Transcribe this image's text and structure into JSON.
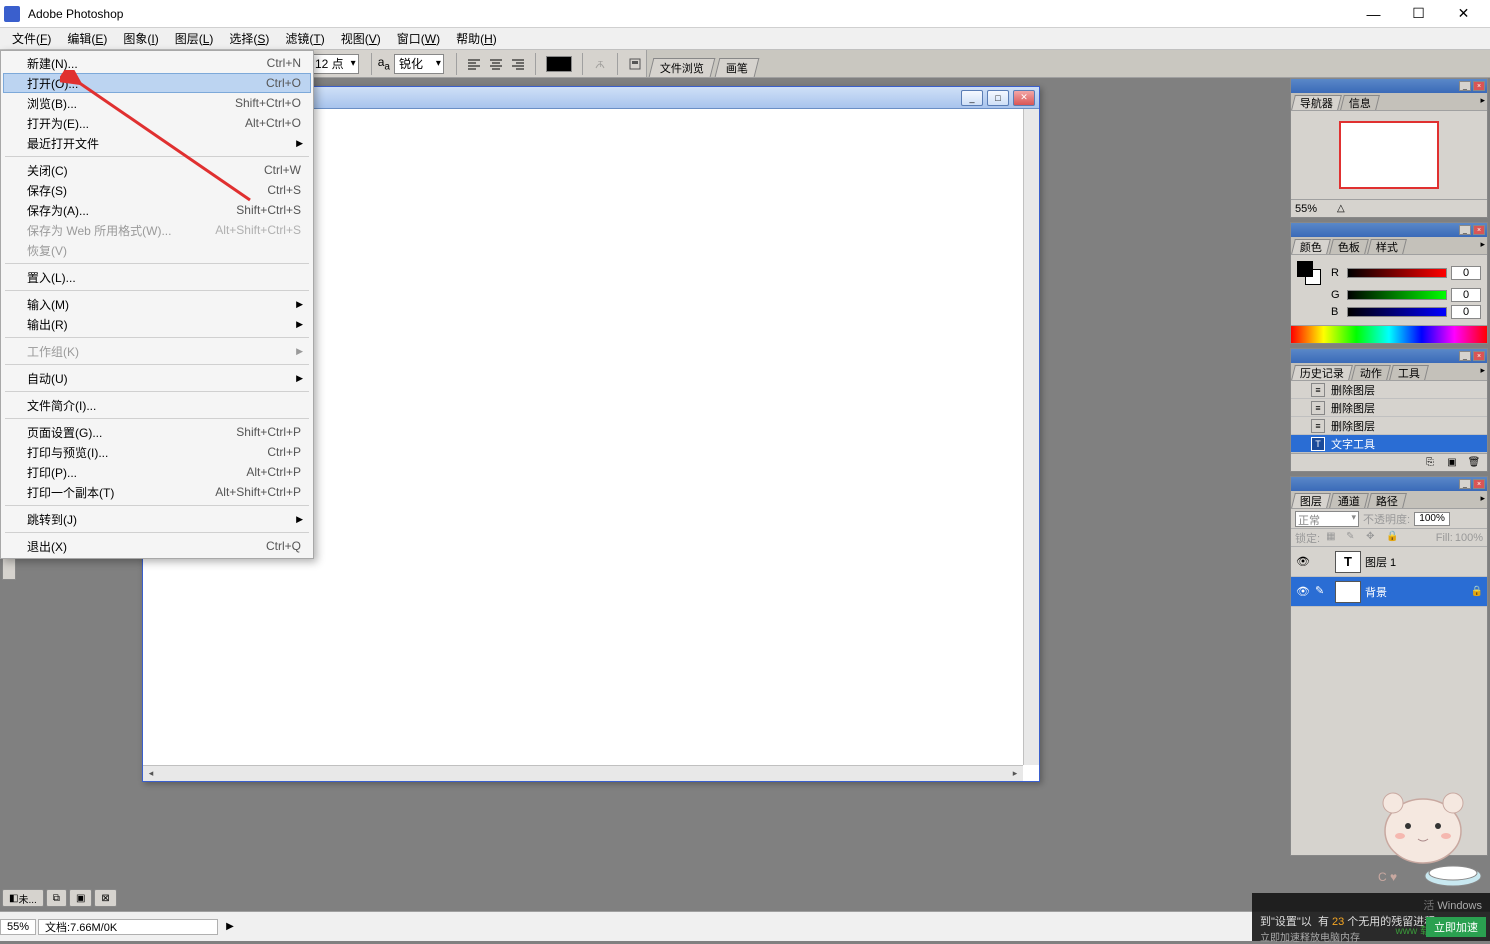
{
  "titlebar": {
    "title": "Adobe Photoshop"
  },
  "menubar": {
    "items": [
      {
        "label": "文件",
        "key": "F"
      },
      {
        "label": "编辑",
        "key": "E"
      },
      {
        "label": "图象",
        "key": "I"
      },
      {
        "label": "图层",
        "key": "L"
      },
      {
        "label": "选择",
        "key": "S"
      },
      {
        "label": "滤镜",
        "key": "T"
      },
      {
        "label": "视图",
        "key": "V"
      },
      {
        "label": "窗口",
        "key": "W"
      },
      {
        "label": "帮助",
        "key": "H"
      }
    ]
  },
  "file_menu": {
    "items": [
      {
        "label": "新建(N)...",
        "shortcut": "Ctrl+N"
      },
      {
        "label": "打开(O)...",
        "shortcut": "Ctrl+O",
        "highlighted": true
      },
      {
        "label": "浏览(B)...",
        "shortcut": "Shift+Ctrl+O"
      },
      {
        "label": "打开为(E)...",
        "shortcut": "Alt+Ctrl+O"
      },
      {
        "label": "最近打开文件",
        "submenu": true
      },
      {
        "sep": true
      },
      {
        "label": "关闭(C)",
        "shortcut": "Ctrl+W"
      },
      {
        "label": "保存(S)",
        "shortcut": "Ctrl+S"
      },
      {
        "label": "保存为(A)...",
        "shortcut": "Shift+Ctrl+S"
      },
      {
        "label": "保存为 Web 所用格式(W)...",
        "shortcut": "Alt+Shift+Ctrl+S",
        "disabled": true
      },
      {
        "label": "恢复(V)",
        "disabled": true
      },
      {
        "sep": true
      },
      {
        "label": "置入(L)..."
      },
      {
        "sep": true
      },
      {
        "label": "输入(M)",
        "submenu": true
      },
      {
        "label": "输出(R)",
        "submenu": true
      },
      {
        "sep": true
      },
      {
        "label": "工作组(K)",
        "submenu": true,
        "disabled": true
      },
      {
        "sep": true
      },
      {
        "label": "自动(U)",
        "submenu": true
      },
      {
        "sep": true
      },
      {
        "label": "文件简介(I)..."
      },
      {
        "sep": true
      },
      {
        "label": "页面设置(G)...",
        "shortcut": "Shift+Ctrl+P"
      },
      {
        "label": "打印与预览(I)...",
        "shortcut": "Ctrl+P"
      },
      {
        "label": "打印(P)...",
        "shortcut": "Alt+Ctrl+P"
      },
      {
        "label": "打印一个副本(T)",
        "shortcut": "Alt+Shift+Ctrl+P"
      },
      {
        "sep": true
      },
      {
        "label": "跳转到(J)",
        "submenu": true
      },
      {
        "sep": true
      },
      {
        "label": "退出(X)",
        "shortcut": "Ctrl+Q"
      }
    ]
  },
  "options": {
    "font_size": "12 点",
    "antialias_label": "aₐ",
    "antialias": "锐化",
    "tab1": "文件浏览",
    "tab2": "画笔"
  },
  "navigator": {
    "tab1": "导航器",
    "tab2": "信息",
    "zoom": "55%"
  },
  "color": {
    "tab1": "颜色",
    "tab2": "色板",
    "tab3": "样式",
    "r_label": "R",
    "r_val": "0",
    "g_label": "G",
    "g_val": "0",
    "b_label": "B",
    "b_val": "0"
  },
  "history": {
    "tab1": "历史记录",
    "tab2": "动作",
    "tab3": "工具",
    "items": [
      {
        "label": "删除图层"
      },
      {
        "label": "删除图层"
      },
      {
        "label": "删除图层"
      },
      {
        "label": "文字工具",
        "selected": true,
        "icon": "T"
      }
    ]
  },
  "layers": {
    "tab1": "图层",
    "tab2": "通道",
    "tab3": "路径",
    "blend_mode": "正常",
    "opacity_label": "不透明度:",
    "opacity": "100%",
    "lock_label": "锁定:",
    "fill_label": "Fill:",
    "fill": "100%",
    "rows": [
      {
        "name": "图层 1",
        "thumb_text": "T"
      },
      {
        "name": "背景",
        "selected": true,
        "locked": true
      }
    ]
  },
  "statusbar": {
    "zoom": "55%",
    "doc_info": "文档:7.66M/0K"
  },
  "task": {
    "item": "未..."
  },
  "popup": {
    "line1_prefix": "有 ",
    "count": "23",
    "line1_suffix": " 个无用的残留进程",
    "line2": "立即加速释放电脑内存",
    "btn": "立即加速",
    "logo": "www 载站"
  },
  "watermark": {
    "text": "Windows"
  }
}
